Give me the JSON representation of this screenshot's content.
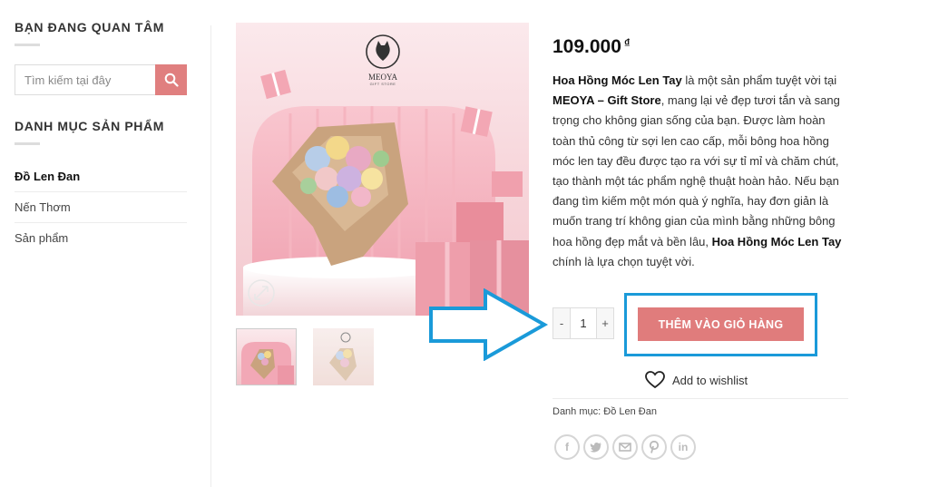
{
  "sidebar": {
    "interest_title": "BẠN ĐANG QUAN TÂM",
    "search_placeholder": "Tìm kiếm tại đây",
    "categories_title": "DANH MỤC SẢN PHẨM",
    "categories": [
      {
        "label": "Đồ Len Đan",
        "active": true
      },
      {
        "label": "Nến Thơm",
        "active": false
      },
      {
        "label": "Sản phẩm",
        "active": false
      }
    ]
  },
  "product": {
    "logo_text": "MEOYA",
    "logo_sub": "GIFT STORE",
    "price": "109.000",
    "currency": "₫",
    "desc": {
      "p1_bold": "Hoa Hồng Móc Len Tay",
      "p2": " là một sản phẩm tuyệt vời tại ",
      "p3_bold": "MEOYA – Gift Store",
      "p4": ", mang lại vẻ đẹp tươi tắn và sang trọng cho không gian sống của bạn. Được làm hoàn toàn thủ công từ sợi len cao cấp, mỗi bông hoa hồng móc len tay đều được tạo ra với sự tỉ mỉ và chăm chút, tạo thành một tác phẩm nghệ thuật hoàn hảo. Nếu bạn đang tìm kiếm một món quà ý nghĩa, hay đơn giản là muốn trang trí không gian của mình bằng những bông hoa hồng đẹp mắt và bền lâu, ",
      "p5_bold": "Hoa Hồng Móc Len Tay",
      "p6": " chính là lựa chọn tuyệt vời."
    },
    "qty_minus": "-",
    "qty_value": "1",
    "qty_plus": "+",
    "add_to_cart": "THÊM VÀO GIỎ HÀNG",
    "wishlist": "Add to wishlist",
    "category_label": "Danh mục:",
    "category_value": "Đồ Len Đan"
  },
  "colors": {
    "accent": "#e07c7c",
    "highlight": "#1a9ad9"
  }
}
